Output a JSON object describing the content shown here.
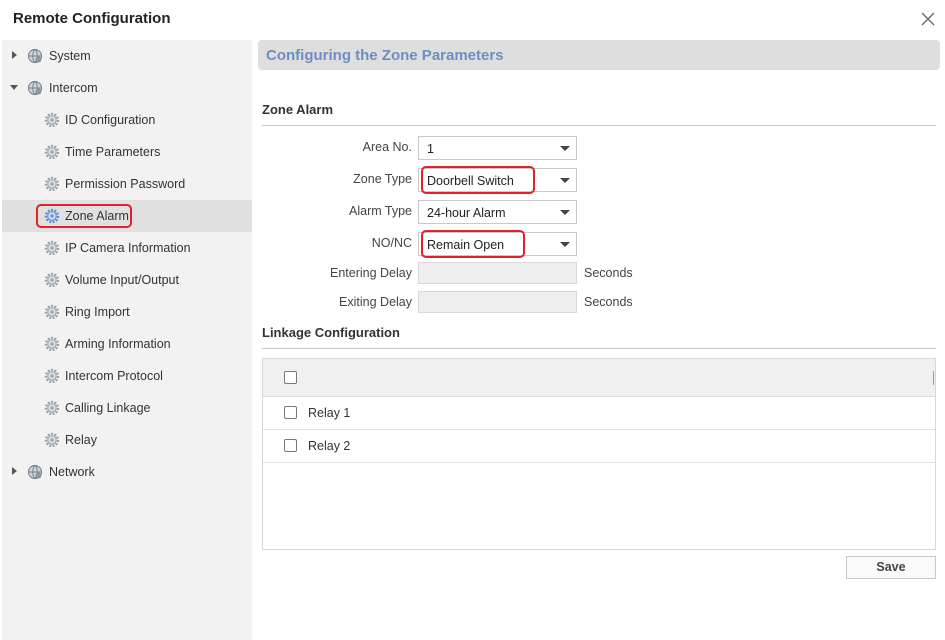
{
  "window": {
    "title": "Remote Configuration"
  },
  "sidebar": {
    "items": [
      {
        "label": "System",
        "level": 0,
        "expanded": false
      },
      {
        "label": "Intercom",
        "level": 0,
        "expanded": true
      },
      {
        "label": "ID Configuration",
        "level": 1
      },
      {
        "label": "Time Parameters",
        "level": 1
      },
      {
        "label": "Permission Password",
        "level": 1
      },
      {
        "label": "Zone Alarm",
        "level": 1,
        "selected": true
      },
      {
        "label": "IP Camera Information",
        "level": 1
      },
      {
        "label": "Volume Input/Output",
        "level": 1
      },
      {
        "label": "Ring Import",
        "level": 1
      },
      {
        "label": "Arming Information",
        "level": 1
      },
      {
        "label": "Intercom Protocol",
        "level": 1
      },
      {
        "label": "Calling Linkage",
        "level": 1
      },
      {
        "label": "Relay",
        "level": 1
      },
      {
        "label": "Network",
        "level": 0,
        "expanded": false
      }
    ]
  },
  "main": {
    "header": "Configuring the Zone Parameters",
    "zone_alarm": {
      "title": "Zone Alarm",
      "area_no": {
        "label": "Area No.",
        "value": "1"
      },
      "zone_type": {
        "label": "Zone Type",
        "value": "Doorbell Switch"
      },
      "alarm_type": {
        "label": "Alarm Type",
        "value": "24-hour Alarm"
      },
      "no_nc": {
        "label": "NO/NC",
        "value": "Remain Open"
      },
      "entering_delay": {
        "label": "Entering Delay",
        "value": "",
        "unit": "Seconds"
      },
      "exiting_delay": {
        "label": "Exiting Delay",
        "value": "",
        "unit": "Seconds"
      }
    },
    "linkage": {
      "title": "Linkage Configuration",
      "rows": [
        {
          "label": "Relay 1",
          "checked": false
        },
        {
          "label": "Relay 2",
          "checked": false
        }
      ]
    },
    "save_label": "Save"
  },
  "colors": {
    "highlight": "#e0202a",
    "header_text": "#6d8fc0"
  }
}
